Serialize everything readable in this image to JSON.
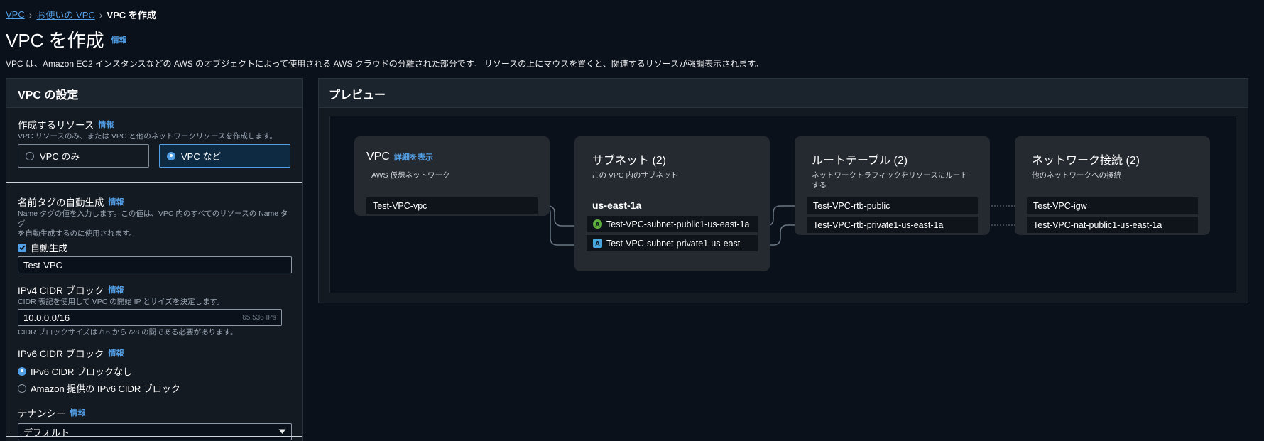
{
  "breadcrumb": {
    "item1": "VPC",
    "item2": "お使いの VPC",
    "current": "VPC を作成"
  },
  "page": {
    "title": "VPC を作成",
    "info": "情報",
    "description": "VPC は、Amazon EC2 インスタンスなどの AWS のオブジェクトによって使用される AWS クラウドの分離された部分です。 リソースの上にマウスを置くと、関連するリソースが強調表示されます。"
  },
  "settings": {
    "header": "VPC の設定",
    "resources": {
      "label": "作成するリソース",
      "info": "情報",
      "desc": "VPC リソースのみ、または VPC と他のネットワークリソースを作成します。",
      "option_vpc_only": "VPC のみ",
      "option_vpc_more": "VPC など",
      "selected": "VPC など"
    },
    "name_tag": {
      "label": "名前タグの自動生成",
      "info": "情報",
      "desc_line1": "Name タグの値を入力します。この値は、VPC 内のすべてのリソースの Name タグ",
      "desc_line2": "を自動生成するのに使用されます。",
      "checkbox_label": "自動生成",
      "checked": true,
      "value": "Test-VPC"
    },
    "ipv4": {
      "label": "IPv4 CIDR ブロック",
      "info": "情報",
      "desc": "CIDR 表記を使用して VPC の開始 IP とサイズを決定します。",
      "value": "10.0.0.0/16",
      "ip_count": "65,536 IPs",
      "hint": "CIDR ブロックサイズは /16 から /28 の間である必要があります。"
    },
    "ipv6": {
      "label": "IPv6 CIDR ブロック",
      "info": "情報",
      "option_none": "IPv6 CIDR ブロックなし",
      "option_amazon": "Amazon 提供の IPv6 CIDR ブロック",
      "selected": "IPv6 CIDR ブロックなし"
    },
    "tenancy": {
      "label": "テナンシー",
      "info": "情報",
      "value": "デフォルト"
    }
  },
  "preview": {
    "header": "プレビュー",
    "vpc": {
      "title": "VPC",
      "details_link": "詳細を表示",
      "subtitle": "AWS 仮想ネットワーク",
      "item": "Test-VPC-vpc"
    },
    "subnets": {
      "title": "サブネット (2)",
      "subtitle": "この VPC 内のサブネット",
      "az": "us-east-1a",
      "items": [
        {
          "badge": "A",
          "name": "Test-VPC-subnet-public1-us-east-1a"
        },
        {
          "badge": "A",
          "name": "Test-VPC-subnet-private1-us-east-"
        }
      ]
    },
    "route_tables": {
      "title": "ルートテーブル (2)",
      "subtitle_line1": "ネットワークトラフィックをリソースにルート",
      "subtitle_line2": "する",
      "items": [
        "Test-VPC-rtb-public",
        "Test-VPC-rtb-private1-us-east-1a"
      ]
    },
    "network": {
      "title": "ネットワーク接続 (2)",
      "subtitle": "他のネットワークへの接続",
      "items": [
        "Test-VPC-igw",
        "Test-VPC-nat-public1-us-east-1a"
      ]
    }
  },
  "colors": {
    "accent": "#539fe5",
    "public_badge": "#5eae3b",
    "private_badge": "#47a8e0",
    "background": "#0b111a",
    "card": "#252a31"
  }
}
